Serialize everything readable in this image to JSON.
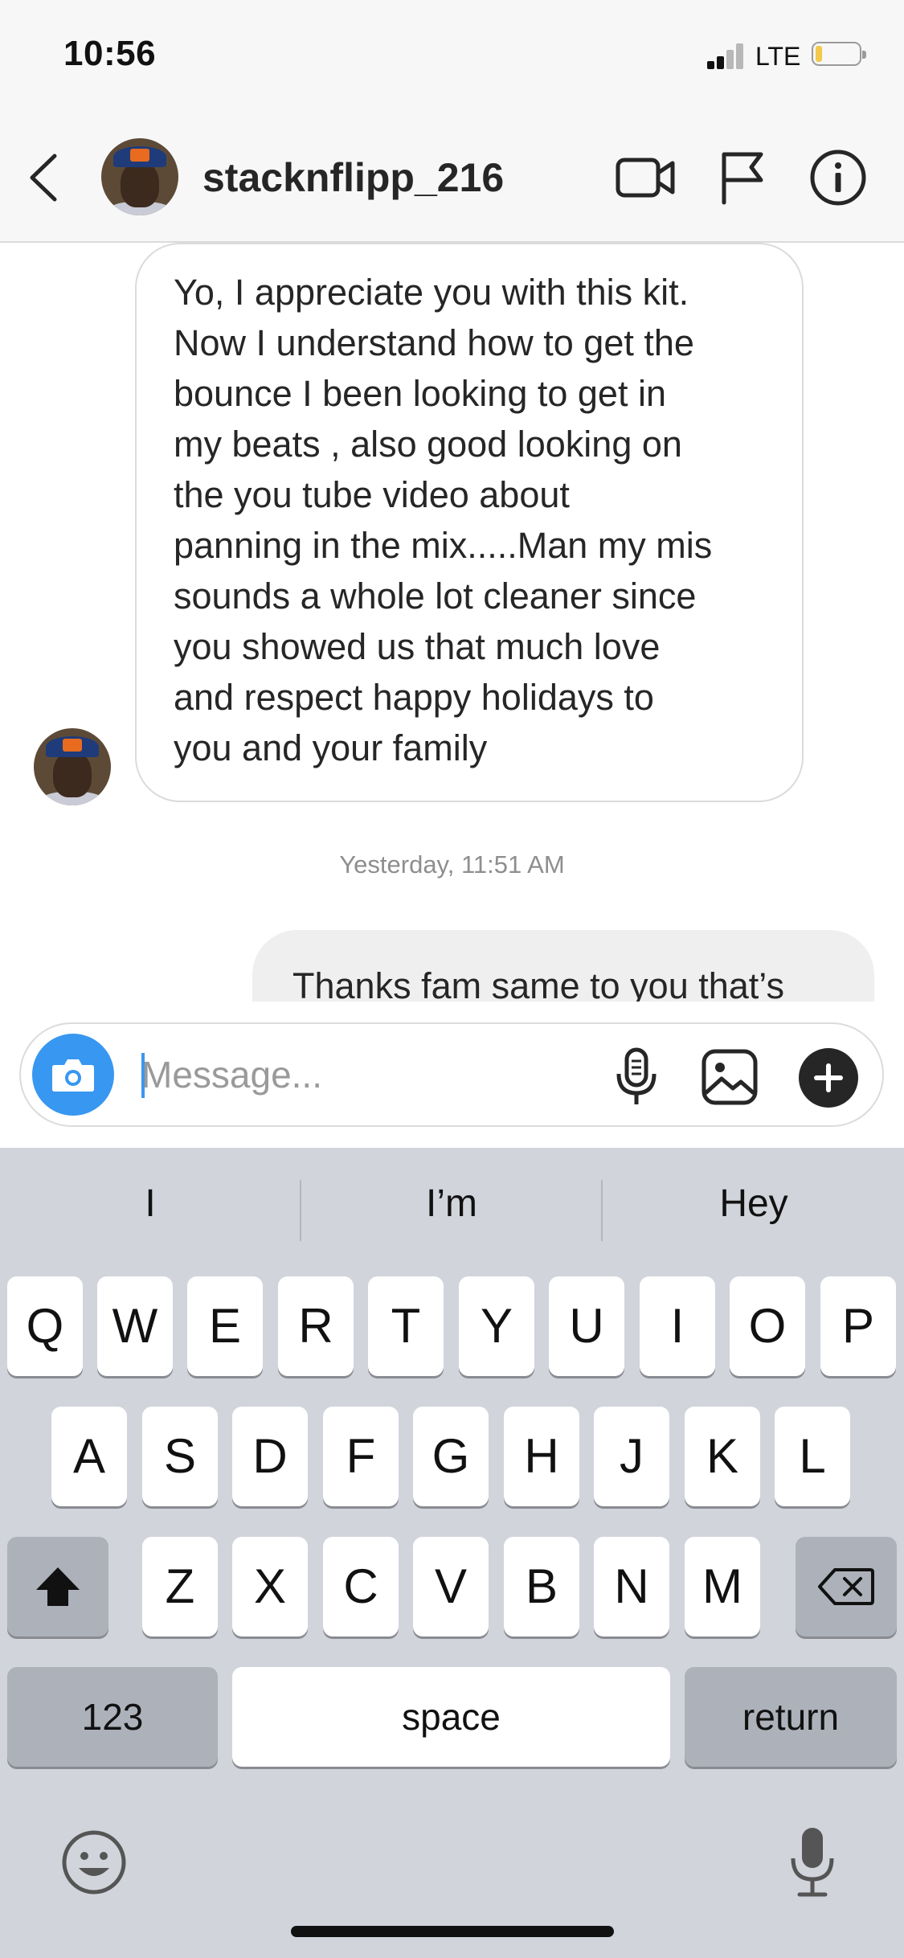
{
  "status_bar": {
    "time": "10:56",
    "network": "LTE",
    "signal_bars": 2,
    "battery_level": 0.15,
    "battery_color": "#f2c94c"
  },
  "header": {
    "username": "stacknflipp_216",
    "icons": [
      "back-chevron-icon",
      "video-call-icon",
      "flag-icon",
      "info-icon"
    ]
  },
  "messages": {
    "incoming_lines": [
      "Yo, I appreciate you  with this kit.",
      "Now I understand how to get the",
      "bounce I been looking to get in",
      "my beats , also good looking on",
      "the you tube video  about",
      "panning in the mix.....Man my mis",
      "sounds a whole lot cleaner since",
      "you showed us that much love",
      "and respect  happy holidays to",
      "you and your family"
    ],
    "timestamp": "Yesterday, 11:51 AM",
    "outgoing_partial": "Thanks fam same to you that’s"
  },
  "composer": {
    "placeholder": "Message...",
    "accent": "#3897f0",
    "icons": [
      "camera-icon",
      "microphone-icon",
      "gallery-icon",
      "plus-icon"
    ]
  },
  "keyboard": {
    "suggestions": [
      "I",
      "I’m",
      "Hey"
    ],
    "row1": [
      "Q",
      "W",
      "E",
      "R",
      "T",
      "Y",
      "U",
      "I",
      "O",
      "P"
    ],
    "row2": [
      "A",
      "S",
      "D",
      "F",
      "G",
      "H",
      "J",
      "K",
      "L"
    ],
    "row3": [
      "Z",
      "X",
      "C",
      "V",
      "B",
      "N",
      "M"
    ],
    "numbers_label": "123",
    "space_label": "space",
    "return_label": "return",
    "icons": [
      "shift-icon",
      "backspace-icon",
      "emoji-icon",
      "dictation-mic-icon"
    ]
  }
}
